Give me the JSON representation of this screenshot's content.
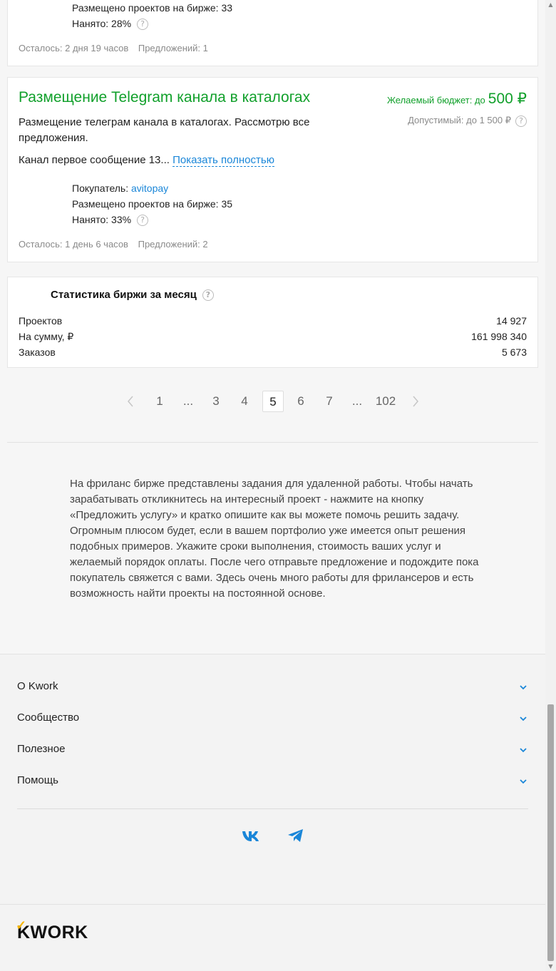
{
  "card1": {
    "projects_label": "Размещено проектов на бирже: 33",
    "hired_label": "Нанято: 28%",
    "time_left": "Осталось: 2 дня 19 часов",
    "offers": "Предложений: 1"
  },
  "card2": {
    "title": "Размещение Telegram канала в каталогах",
    "budget_label": "Желаемый бюджет: до",
    "budget_value": "500 ₽",
    "allowed": "Допустимый: до 1 500 ₽",
    "description": "Размещение телеграм канала в каталогах. Рассмотрю все предложения.",
    "excerpt": "Канал первое сообщение 13...",
    "show_more": "Показать полностью",
    "buyer_label": "Покупатель:",
    "buyer_name": "avitopay",
    "projects_label": "Размещено проектов на бирже: 35",
    "hired_label": "Нанято: 33%",
    "time_left": "Осталось: 1 день 6 часов",
    "offers": "Предложений: 2"
  },
  "stats": {
    "title": "Статистика биржи за месяц",
    "rows": [
      {
        "label": "Проектов",
        "value": "14 927"
      },
      {
        "label": "На сумму,  ₽",
        "value": "161 998 340"
      },
      {
        "label": "Заказов",
        "value": "5 673"
      }
    ]
  },
  "pagination": {
    "pages": [
      "1",
      "...",
      "3",
      "4",
      "5",
      "6",
      "7",
      "...",
      "102"
    ],
    "current": "5",
    "prev_icon": "chevron-left-icon",
    "next_icon": "chevron-right-icon"
  },
  "about_text": "На фриланс бирже представлены задания для удаленной работы. Чтобы начать зарабатывать откликнитесь на интересный проект - нажмите на кнопку «Предложить услугу» и кратко опишите как вы можете помочь решить задачу. Огромным плюсом будет, если в вашем портфолио уже имеется опыт решения подобных примеров. Укажите сроки выполнения, стоимость ваших услуг и желаемый порядок оплаты. После чего отправьте предложение и подождите пока покупатель свяжется с вами. Здесь очень много работы для фрилансеров и есть возможность найти проекты на постоянной основе.",
  "footer": {
    "nav": [
      "О Kwork",
      "Сообщество",
      "Полезное",
      "Помощь"
    ],
    "social": [
      "vk-icon",
      "telegram-icon"
    ],
    "logo": "KWORK"
  },
  "colors": {
    "accent_green": "#11a02b",
    "link_blue": "#1a86d8",
    "logo_yellow": "#f6b500"
  }
}
